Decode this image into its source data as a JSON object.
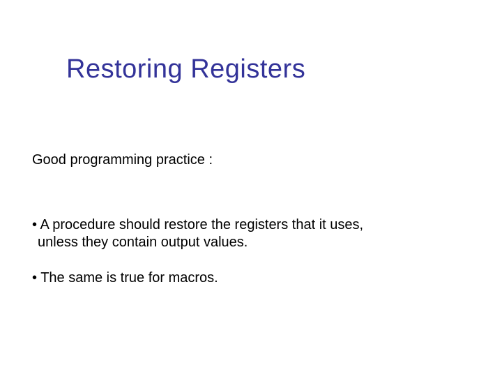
{
  "slide": {
    "title": "Restoring Registers",
    "subhead": "Good programming practice :",
    "bullets": [
      {
        "line1": "A procedure should restore the registers that it uses,",
        "line2": "unless they contain output values."
      },
      {
        "line1": "The same is true for macros.",
        "line2": ""
      }
    ]
  }
}
